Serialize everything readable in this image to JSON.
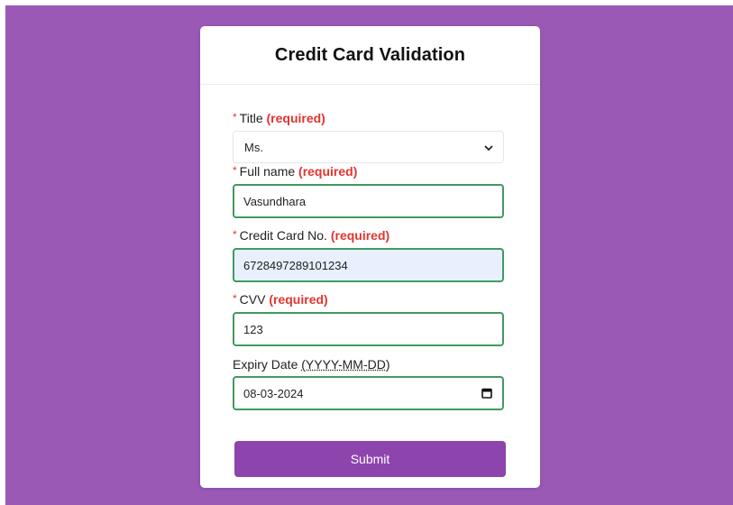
{
  "form": {
    "title": "Credit Card Validation",
    "required_marker": "*",
    "required_text": "(required)",
    "title_field": {
      "label": "Title",
      "value": "Ms."
    },
    "full_name": {
      "label": "Full name",
      "value": "Vasundhara"
    },
    "card_number": {
      "label": "Credit Card No.",
      "value": "6728497289101234"
    },
    "cvv": {
      "label": "CVV",
      "value": "123"
    },
    "expiry": {
      "label": "Expiry Date",
      "format": "(YYYY-MM-DD)",
      "value": "08-03-2024"
    },
    "submit_label": "Submit"
  },
  "colors": {
    "background": "#9b59b6",
    "button": "#8e44ad",
    "required": "#e3342f",
    "valid_border": "#3f9b5f",
    "autofill_bg": "#e8f0fe"
  },
  "icons": {
    "select": "chevron-down-icon",
    "date": "calendar-icon"
  }
}
